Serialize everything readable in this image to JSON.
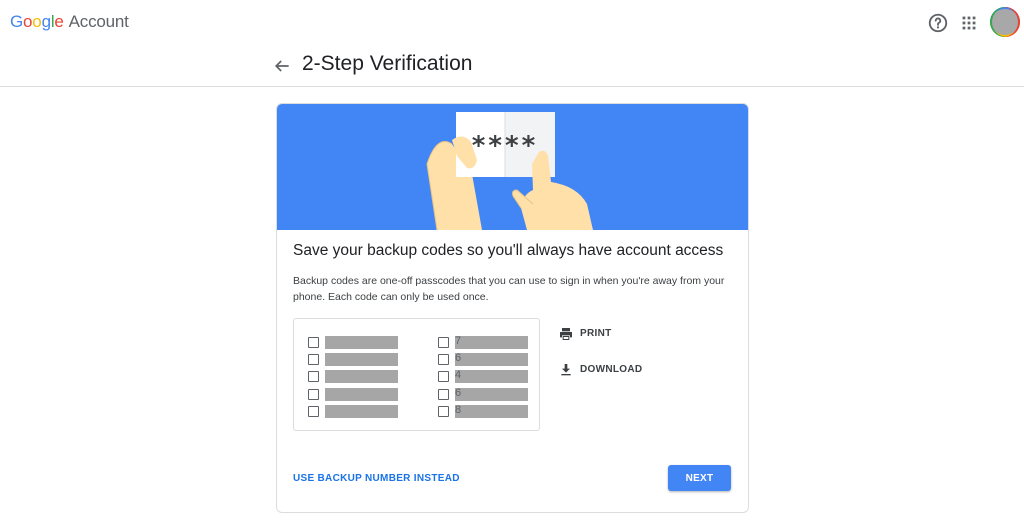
{
  "header": {
    "logo_letters": [
      "G",
      "o",
      "o",
      "g",
      "l",
      "e"
    ],
    "logo_suffix": "Account",
    "help_icon": "help-circle-icon",
    "apps_icon": "apps-grid-icon"
  },
  "page": {
    "title": "2-Step Verification",
    "back_icon": "arrow-back-icon"
  },
  "card": {
    "hero_color": "#4285F4",
    "hero_text": "****",
    "title": "Save your backup codes so you'll always have account access",
    "description": "Backup codes are one-off passcodes that you can use to sign in when you're away from your phone. Each code can only be used once.",
    "codes_left": [
      "",
      "",
      "",
      "",
      ""
    ],
    "codes_right": [
      "7",
      "6",
      "4",
      "6",
      "8"
    ],
    "actions": {
      "print": "PRINT",
      "download": "DOWNLOAD"
    },
    "use_backup_number": "USE BACKUP NUMBER INSTEAD",
    "next": "NEXT"
  }
}
